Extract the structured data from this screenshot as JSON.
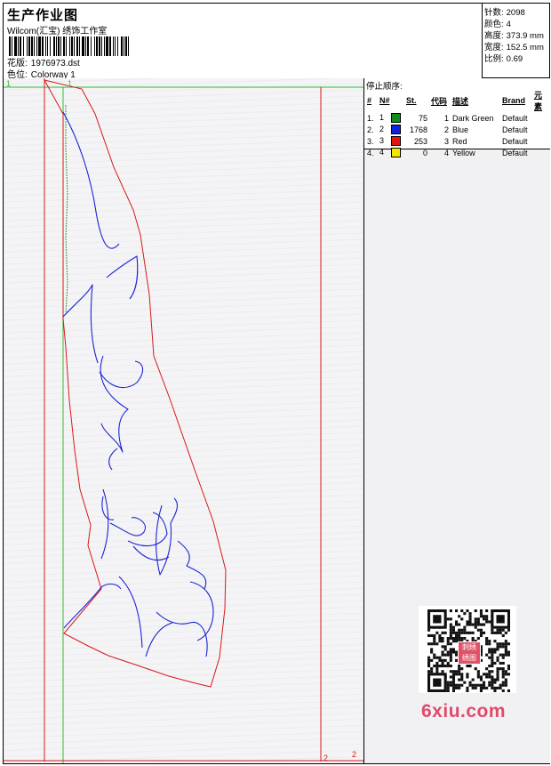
{
  "header": {
    "title": "生产作业图",
    "company": "Wilcom(汇宝) 绣饰工作室",
    "design_label": "花版:",
    "design_value": "1976973.dst",
    "colorway_label": "色位:",
    "colorway_value": "Colorway 1"
  },
  "stats": [
    {
      "label": "针数:",
      "value": "2098"
    },
    {
      "label": "颜色:",
      "value": "4"
    },
    {
      "label": "高度:",
      "value": "373.9 mm"
    },
    {
      "label": "宽度:",
      "value": "152.5 mm"
    },
    {
      "label": "比例:",
      "value": "0.69"
    }
  ],
  "stops": {
    "title": "停止顺序:",
    "columns": [
      "#",
      "N#",
      "St.",
      "代码",
      "描述",
      "Brand",
      "元素"
    ],
    "rows": [
      {
        "order": "1.",
        "n": "1",
        "color": "#118a1e",
        "stitches": "75",
        "code": "1",
        "desc": "Dark Green",
        "brand": "Default",
        "element": ""
      },
      {
        "order": "2.",
        "n": "2",
        "color": "#1020d8",
        "stitches": "1768",
        "code": "2",
        "desc": "Blue",
        "brand": "Default",
        "element": ""
      },
      {
        "order": "3.",
        "n": "3",
        "color": "#e01414",
        "stitches": "253",
        "code": "3",
        "desc": "Red",
        "brand": "Default",
        "element": ""
      },
      {
        "order": "4.",
        "n": "4",
        "color": "#f0e800",
        "stitches": "0",
        "code": "4",
        "desc": "Yellow",
        "brand": "Default",
        "element": ""
      }
    ]
  },
  "markers": {
    "top_left_green": "1",
    "top_green": "1",
    "bottom_red_a": "2",
    "bottom_red_b": "2"
  },
  "colors": {
    "green_guide": "#2ac02a",
    "red_guide": "#d81818",
    "blue_stitch": "#1a24d4",
    "dashed_green": "#3a9a3a"
  },
  "watermark": {
    "text": "6xiu.com",
    "badge": "刺绣 绣图"
  }
}
